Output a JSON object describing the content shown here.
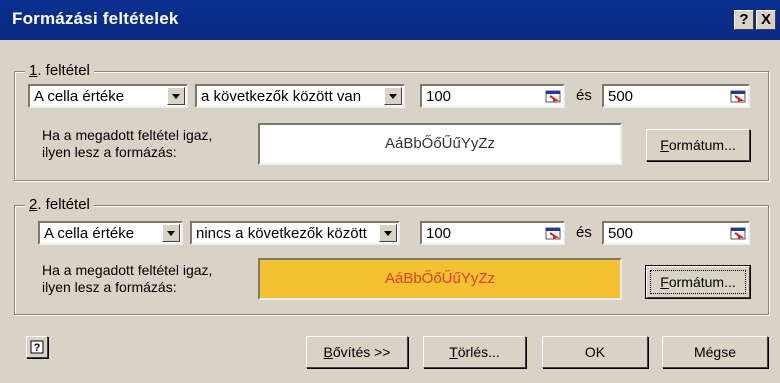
{
  "window": {
    "title": "Formázási feltételek",
    "help_btn": "?",
    "close_btn": "X"
  },
  "condition1": {
    "label_underlined": "1",
    "label_rest": ". feltétel",
    "type_value": "A cella értéke",
    "operator_value": "a következők között van",
    "value1": "100",
    "and_label": "és",
    "value2": "500",
    "prompt_line1": "Ha a megadott feltétel igaz,",
    "prompt_line2": "ilyen lesz a formázás:",
    "preview_text": "AáBbŐőŰűYyZz",
    "format_btn_u": "F",
    "format_btn_rest": "ormátum...",
    "preview_bg": "#ffffff",
    "preview_color": "#333333"
  },
  "condition2": {
    "label_underlined": "2",
    "label_rest": ". feltétel",
    "type_value": "A cella értéke",
    "operator_value": "nincs a következők között",
    "value1": "100",
    "and_label": "és",
    "value2": "500",
    "prompt_line1": "Ha a megadott feltétel igaz,",
    "prompt_line2": "ilyen lesz a formázás:",
    "preview_text": "AáBbŐőŰűYyZz",
    "format_btn_u": "F",
    "format_btn_rest": "ormátum...",
    "preview_bg": "#f2c232",
    "preview_color": "#e83a2a"
  },
  "footer": {
    "help_icon": "help-question-icon",
    "expand_btn_u": "B",
    "expand_btn_rest": "ővítés >>",
    "delete_btn_u": "T",
    "delete_btn_rest": "örlés...",
    "ok_btn": "OK",
    "cancel_btn": "Mégse"
  },
  "colors": {
    "titlebar": "#0a2f8e",
    "dialog_bg": "#d9d3c7"
  }
}
